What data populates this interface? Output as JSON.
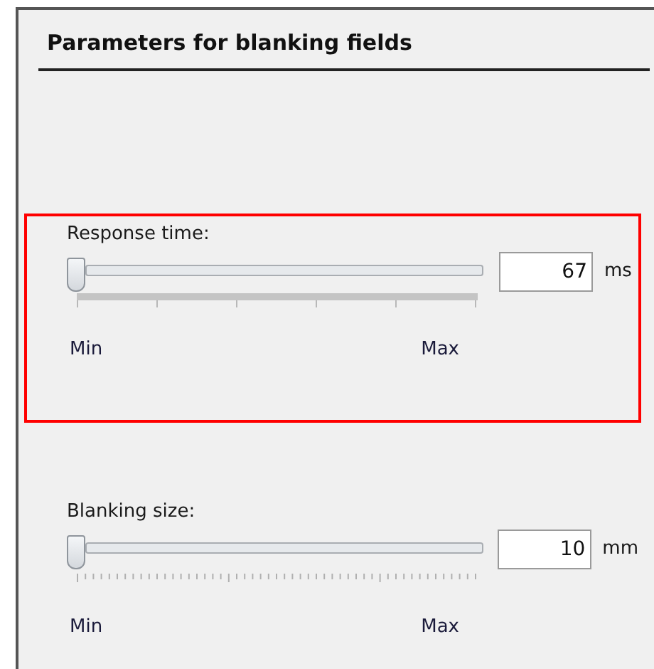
{
  "panel": {
    "title": "Parameters for blanking fields"
  },
  "parameters": [
    {
      "label": "Response time:",
      "kind": "coarse",
      "highlighted": true,
      "level": 0,
      "value": "67",
      "unit": "ms",
      "min_label": "Min",
      "max_label": "Max"
    },
    {
      "label": "Blanking size:",
      "kind": "fine",
      "highlighted": false,
      "level": 0,
      "value": "10",
      "unit": "mm",
      "min_label": "Min",
      "max_label": "Max"
    }
  ]
}
